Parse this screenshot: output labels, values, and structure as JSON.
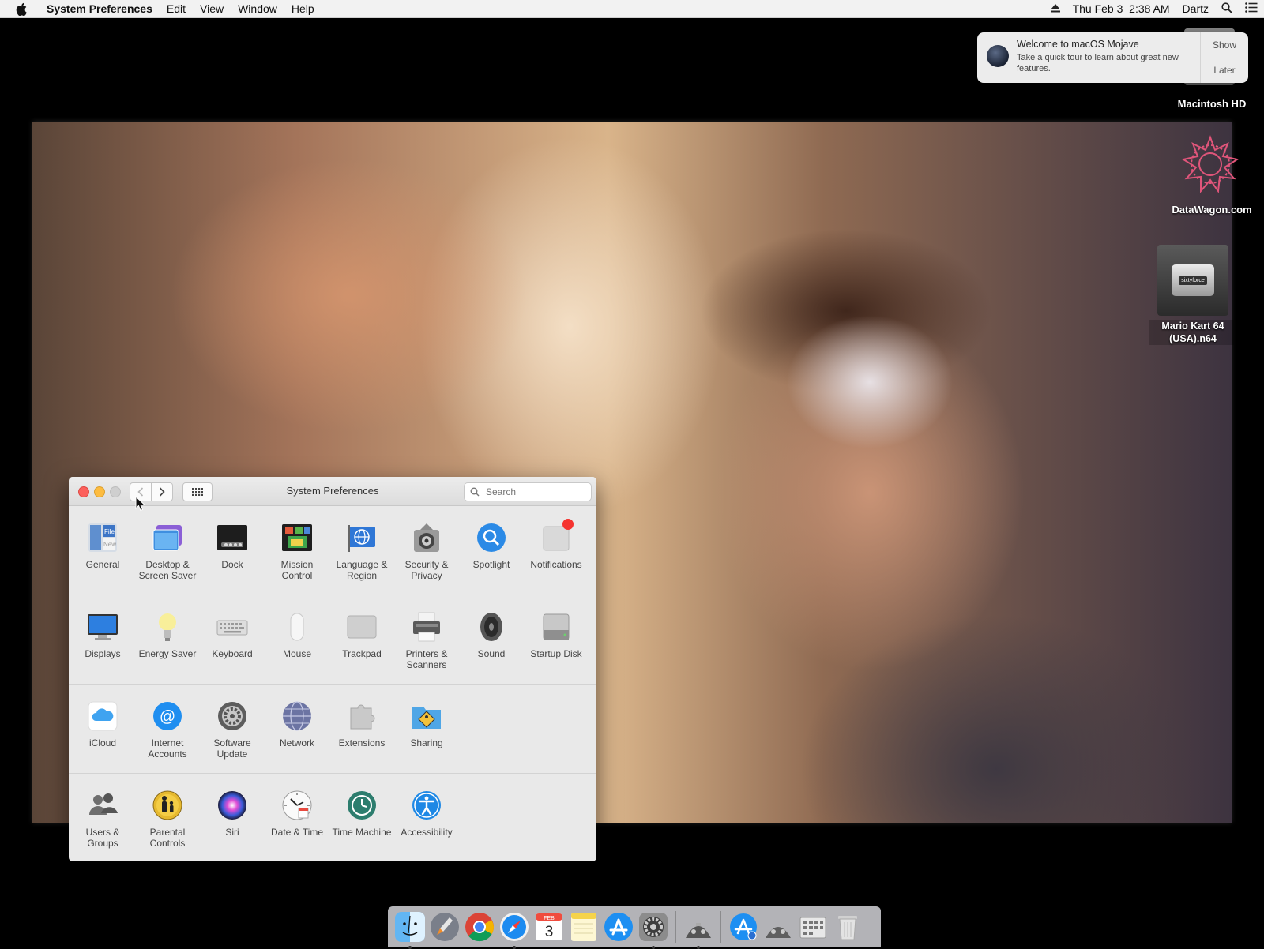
{
  "menubar": {
    "app_name": "System Preferences",
    "menus": [
      "Edit",
      "View",
      "Window",
      "Help"
    ],
    "datetime": "Thu Feb 3  2:38 AM",
    "user": "Dartz",
    "icons": [
      "apple-icon",
      "eject-icon",
      "spotlight-search-icon",
      "notification-center-icon"
    ]
  },
  "notification": {
    "title": "Welcome to macOS Mojave",
    "body": "Take a quick tour to learn about great new features.",
    "show_label": "Show",
    "later_label": "Later"
  },
  "desktop": {
    "hd_label": "Macintosh HD",
    "datawagon_label": "DataWagon.com",
    "cartridge_brand": "sixtyforce",
    "mario_label_line1": "Mario Kart 64",
    "mario_label_line2": "(USA).n64"
  },
  "window": {
    "title": "System Preferences",
    "search_placeholder": "Search",
    "sections": [
      [
        {
          "label": "General",
          "icon": "general-icon"
        },
        {
          "label": "Desktop & Screen Saver",
          "icon": "desktop-screen-saver-icon"
        },
        {
          "label": "Dock",
          "icon": "dock-icon"
        },
        {
          "label": "Mission Control",
          "icon": "mission-control-icon"
        },
        {
          "label": "Language & Region",
          "icon": "language-region-icon"
        },
        {
          "label": "Security & Privacy",
          "icon": "security-privacy-icon"
        },
        {
          "label": "Spotlight",
          "icon": "spotlight-icon"
        },
        {
          "label": "Notifications",
          "icon": "notifications-icon"
        }
      ],
      [
        {
          "label": "Displays",
          "icon": "displays-icon"
        },
        {
          "label": "Energy Saver",
          "icon": "energy-saver-icon"
        },
        {
          "label": "Keyboard",
          "icon": "keyboard-icon"
        },
        {
          "label": "Mouse",
          "icon": "mouse-icon"
        },
        {
          "label": "Trackpad",
          "icon": "trackpad-icon"
        },
        {
          "label": "Printers & Scanners",
          "icon": "printers-scanners-icon"
        },
        {
          "label": "Sound",
          "icon": "sound-icon"
        },
        {
          "label": "Startup Disk",
          "icon": "startup-disk-icon"
        }
      ],
      [
        {
          "label": "iCloud",
          "icon": "icloud-icon"
        },
        {
          "label": "Internet Accounts",
          "icon": "internet-accounts-icon"
        },
        {
          "label": "Software Update",
          "icon": "software-update-icon"
        },
        {
          "label": "Network",
          "icon": "network-icon"
        },
        {
          "label": "Extensions",
          "icon": "extensions-icon"
        },
        {
          "label": "Sharing",
          "icon": "sharing-icon"
        }
      ],
      [
        {
          "label": "Users & Groups",
          "icon": "users-groups-icon"
        },
        {
          "label": "Parental Controls",
          "icon": "parental-controls-icon"
        },
        {
          "label": "Siri",
          "icon": "siri-icon"
        },
        {
          "label": "Date & Time",
          "icon": "date-time-icon"
        },
        {
          "label": "Time Machine",
          "icon": "time-machine-icon"
        },
        {
          "label": "Accessibility",
          "icon": "accessibility-icon"
        }
      ]
    ]
  },
  "dock": {
    "calendar_day": "3",
    "calendar_month": "FEB",
    "items": [
      "finder-icon",
      "launchpad-icon",
      "chrome-icon",
      "safari-icon",
      "calendar-icon",
      "notes-icon",
      "app-store-icon",
      "system-preferences-icon",
      "sixtyforce-icon",
      "app-store-downloads-icon",
      "sixtyforce-stack-icon",
      "utilities-stack-icon",
      "trash-icon"
    ]
  },
  "colors": {
    "close": "#fc605c",
    "minimize": "#fdbc40",
    "notification_badge": "#f5332f",
    "accent_blue": "#1e88e5"
  }
}
